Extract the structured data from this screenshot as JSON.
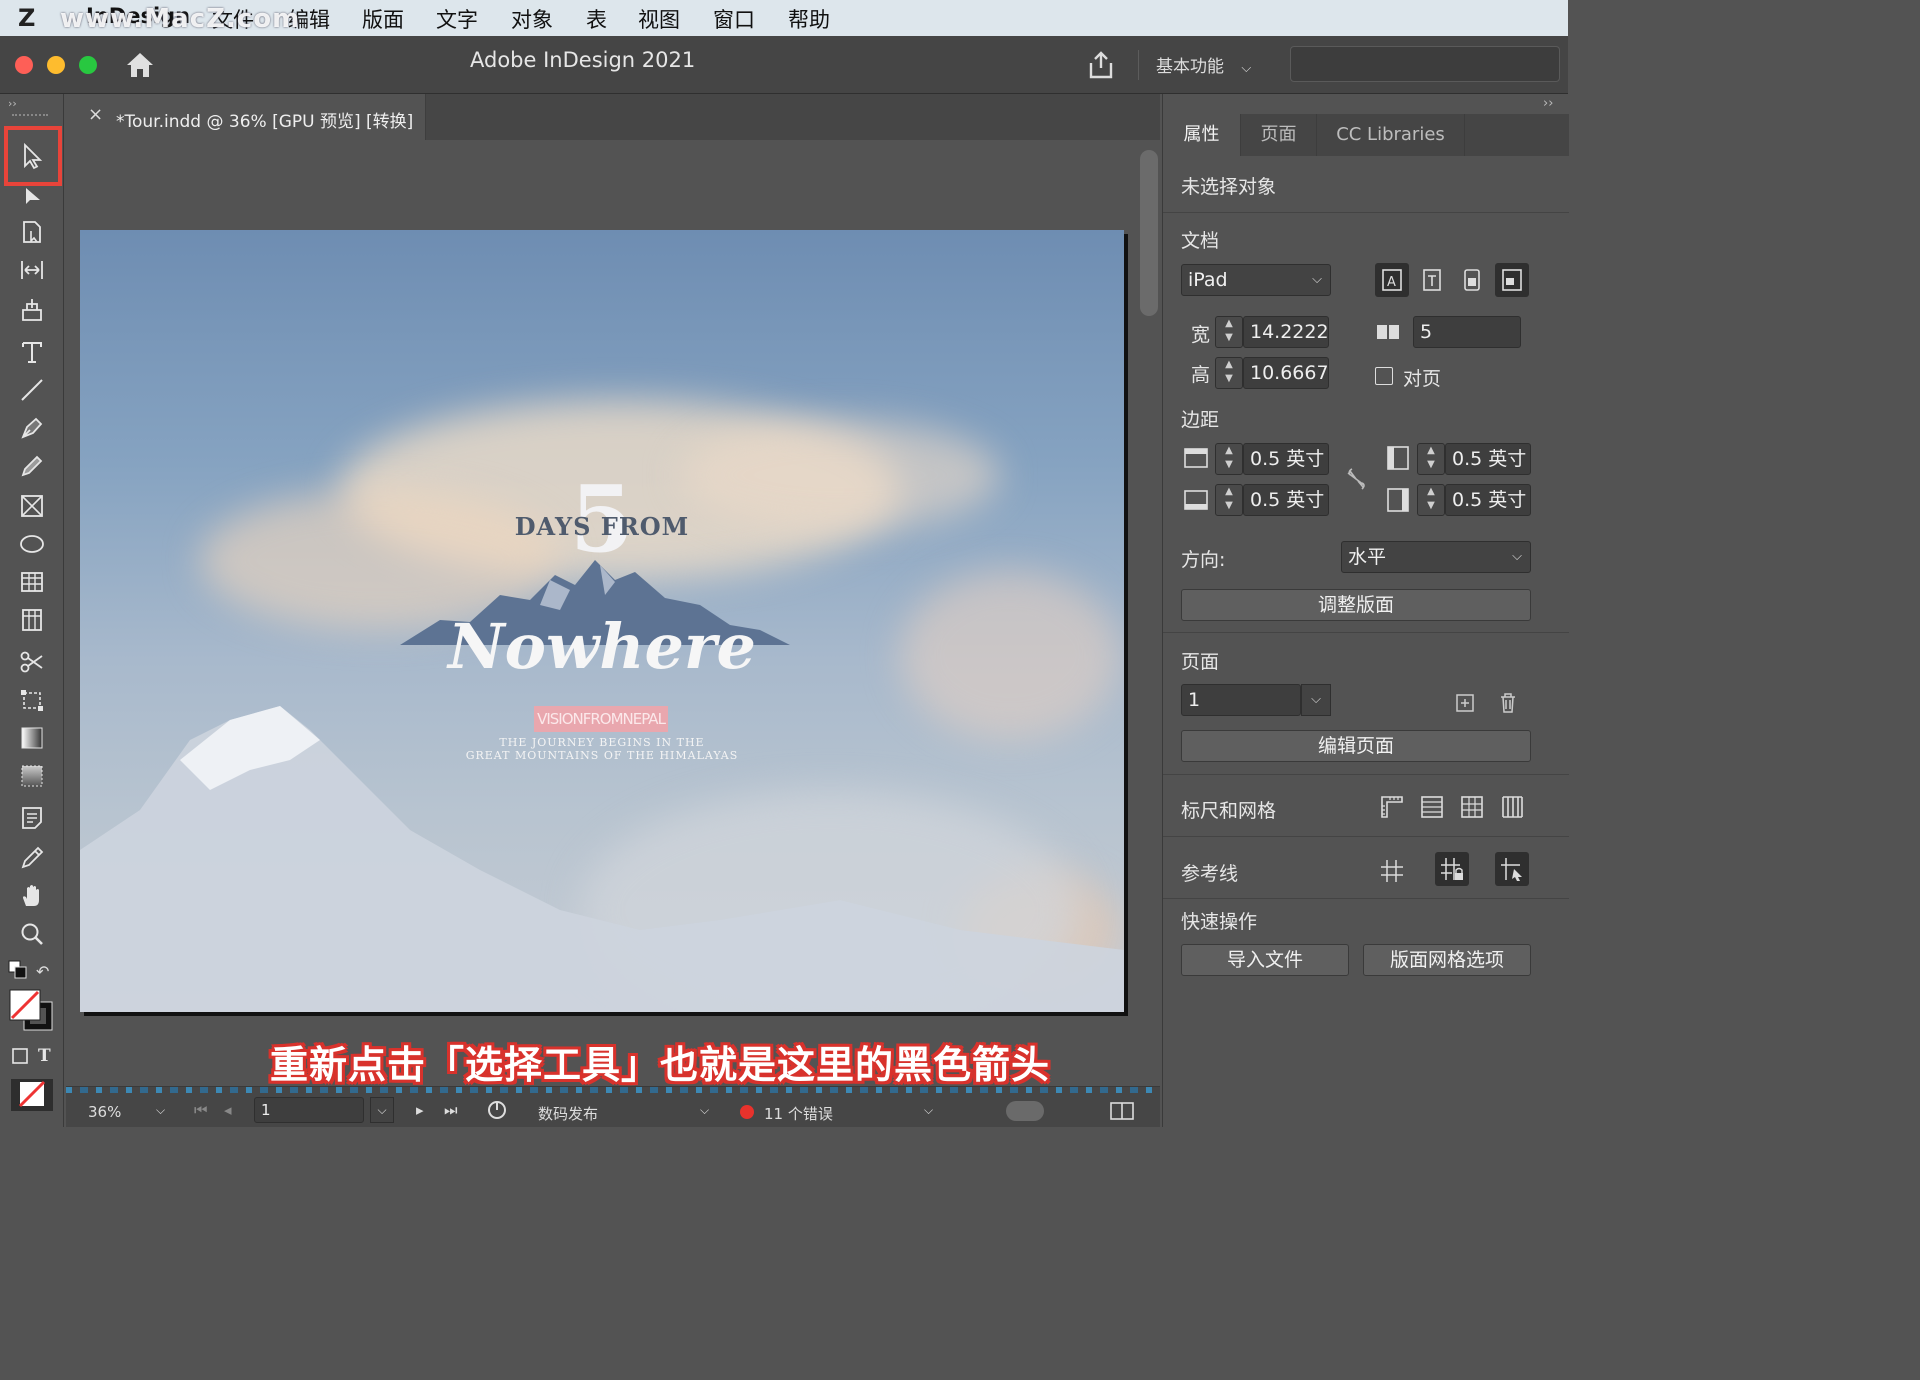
{
  "menubar": {
    "watermark": "www.MacZ.com",
    "logo": "Z",
    "items": [
      "InDesign",
      "文件",
      "编辑",
      "版面",
      "文字",
      "对象",
      "表",
      "视图",
      "窗口",
      "帮助"
    ]
  },
  "window": {
    "title": "Adobe InDesign 2021",
    "workspace": "基本功能",
    "traffic_colors": [
      "#fe5f57",
      "#febc2e",
      "#28c840"
    ]
  },
  "document": {
    "tab_close": "×",
    "tab_title": "*Tour.indd @ 36% [GPU 预览] [转换]"
  },
  "poster": {
    "number": "5",
    "days_from": "DAYS FROM",
    "nowhere": "Nowhere",
    "vision": "VISIONFROMNEPAL",
    "line1": "THE JOURNEY BEGINS IN THE",
    "line2": "GREAT MOUNTAINS OF THE HIMALAYAS"
  },
  "caption": "重新点击「选择工具」也就是这里的黑色箭头",
  "statusbar": {
    "zoom": "36%",
    "page": "1",
    "profile": "数码发布",
    "errors": "11 个错误"
  },
  "panel": {
    "tabs": [
      "属性",
      "页面",
      "CC Libraries"
    ],
    "selection": "未选择对象",
    "doc_section": "文档",
    "preset": "iPad",
    "width_label": "宽",
    "width": "14.2222",
    "height_label": "高",
    "height": "10.6667",
    "pages_count": "5",
    "facing_pages": "对页",
    "margin_section": "边距",
    "margin_top": "0.5 英寸",
    "margin_bottom": "0.5 英寸",
    "margin_left": "0.5 英寸",
    "margin_right": "0.5 英寸",
    "orientation_label": "方向:",
    "orientation": "水平",
    "adjust_layout": "调整版面",
    "pages_section": "页面",
    "page_value": "1",
    "edit_page": "编辑页面",
    "rulers_grids": "标尺和网格",
    "guides": "参考线",
    "quick_actions": "快速操作",
    "import_file": "导入文件",
    "layout_grid_options": "版面网格选项"
  }
}
